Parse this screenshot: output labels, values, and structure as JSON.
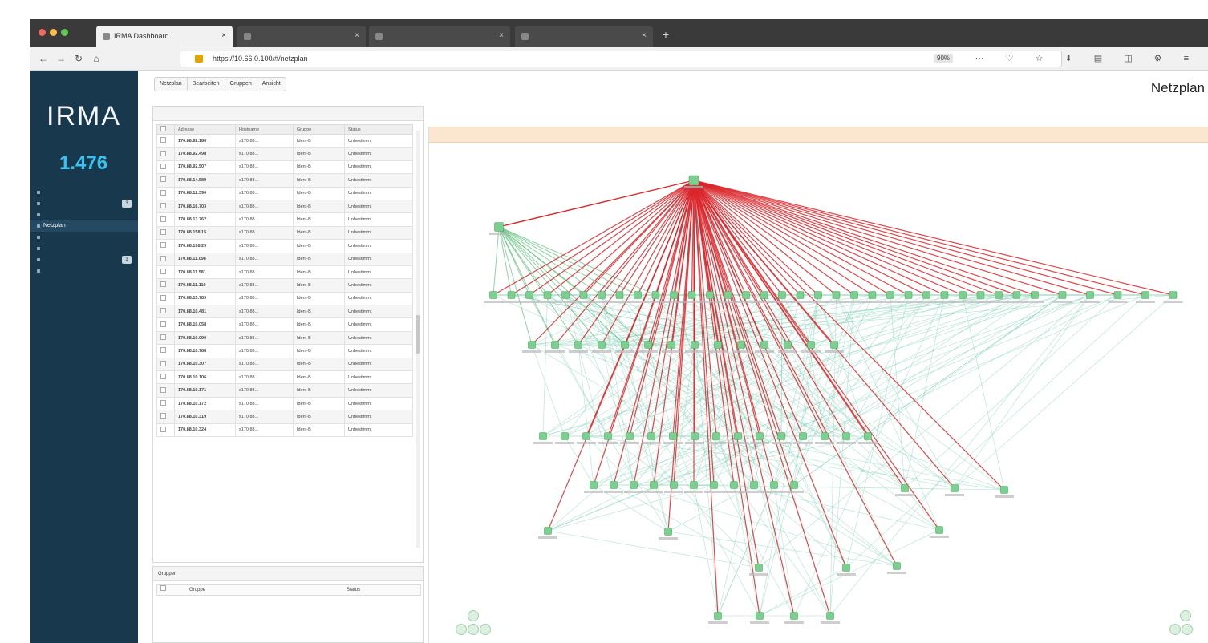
{
  "browser": {
    "tabs": [
      {
        "label": "IRMA Dashboard",
        "active": true
      },
      {
        "label": "",
        "active": false
      },
      {
        "label": "",
        "active": false
      },
      {
        "label": "",
        "active": false
      }
    ],
    "url": "https://10.66.0.100/#/netzplan",
    "zoom": "90%"
  },
  "sidebar": {
    "logo": "IRMA",
    "stat_value": "1.476",
    "items": [
      {
        "label": "",
        "badge": ""
      },
      {
        "label": "",
        "badge": "3"
      },
      {
        "label": "",
        "badge": ""
      },
      {
        "label": "Netzplan",
        "badge": "",
        "active": true
      },
      {
        "label": "",
        "badge": ""
      },
      {
        "label": "",
        "badge": ""
      },
      {
        "label": "",
        "badge": "3"
      },
      {
        "label": "",
        "badge": ""
      }
    ]
  },
  "page": {
    "title": "Netzplan",
    "menu": [
      "Netzplan",
      "Bearbeiten",
      "Gruppen",
      "Ansicht"
    ]
  },
  "table": {
    "columns": [
      "",
      "Adresse",
      "Hostname",
      "Gruppe",
      "Status"
    ],
    "rows": [
      {
        "ip": "170.88.92.186",
        "host": "s170.88...",
        "group": "Ident-B",
        "status": "Unbestimmt"
      },
      {
        "ip": "170.88.92.498",
        "host": "s170.88...",
        "group": "Ident-B",
        "status": "Unbestimmt"
      },
      {
        "ip": "170.88.92.507",
        "host": "s170.88...",
        "group": "Ident-B",
        "status": "Unbestimmt"
      },
      {
        "ip": "170.88.14.589",
        "host": "s170.88...",
        "group": "Ident-B",
        "status": "Unbestimmt"
      },
      {
        "ip": "170.88.12.390",
        "host": "s170.88...",
        "group": "Ident-B",
        "status": "Unbestimmt"
      },
      {
        "ip": "170.88.16.703",
        "host": "s170.88...",
        "group": "Ident-B",
        "status": "Unbestimmt"
      },
      {
        "ip": "170.88.13.762",
        "host": "s170.88...",
        "group": "Ident-B",
        "status": "Unbestimmt"
      },
      {
        "ip": "170.88.158.15",
        "host": "s170.88...",
        "group": "Ident-B",
        "status": "Unbestimmt"
      },
      {
        "ip": "170.88.198.29",
        "host": "s170.88...",
        "group": "Ident-B",
        "status": "Unbestimmt"
      },
      {
        "ip": "170.88.11.098",
        "host": "s170.88...",
        "group": "Ident-B",
        "status": "Unbestimmt"
      },
      {
        "ip": "170.88.11.581",
        "host": "s170.88...",
        "group": "Ident-B",
        "status": "Unbestimmt"
      },
      {
        "ip": "170.88.11.110",
        "host": "s170.88...",
        "group": "Ident-B",
        "status": "Unbestimmt"
      },
      {
        "ip": "170.88.15.789",
        "host": "s170.88...",
        "group": "Ident-B",
        "status": "Unbestimmt"
      },
      {
        "ip": "170.88.10.481",
        "host": "s170.88...",
        "group": "Ident-B",
        "status": "Unbestimmt"
      },
      {
        "ip": "170.88.10.058",
        "host": "s170.88...",
        "group": "Ident-B",
        "status": "Unbestimmt"
      },
      {
        "ip": "170.88.10.090",
        "host": "s170.88...",
        "group": "Ident-B",
        "status": "Unbestimmt"
      },
      {
        "ip": "170.88.10.788",
        "host": "s170.88...",
        "group": "Ident-B",
        "status": "Unbestimmt"
      },
      {
        "ip": "170.88.10.307",
        "host": "s170.88...",
        "group": "Ident-B",
        "status": "Unbestimmt"
      },
      {
        "ip": "170.88.10.106",
        "host": "s170.88...",
        "group": "Ident-B",
        "status": "Unbestimmt"
      },
      {
        "ip": "170.88.10.171",
        "host": "s170.88...",
        "group": "Ident-B",
        "status": "Unbestimmt"
      },
      {
        "ip": "170.88.10.172",
        "host": "s170.88...",
        "group": "Ident-B",
        "status": "Unbestimmt"
      },
      {
        "ip": "170.88.10.319",
        "host": "s170.88...",
        "group": "Ident-B",
        "status": "Unbestimmt"
      },
      {
        "ip": "170.88.10.324",
        "host": "s170.88...",
        "group": "Ident-B",
        "status": "Unbestimmt"
      }
    ]
  },
  "groups": {
    "title": "Gruppen",
    "column": "Gruppe",
    "column2": "Status"
  },
  "network": {
    "colors": {
      "red": "#d9262a",
      "green": "#5fbf7c",
      "node": "#7bcf8f",
      "teal": "#7ccfb3"
    }
  }
}
